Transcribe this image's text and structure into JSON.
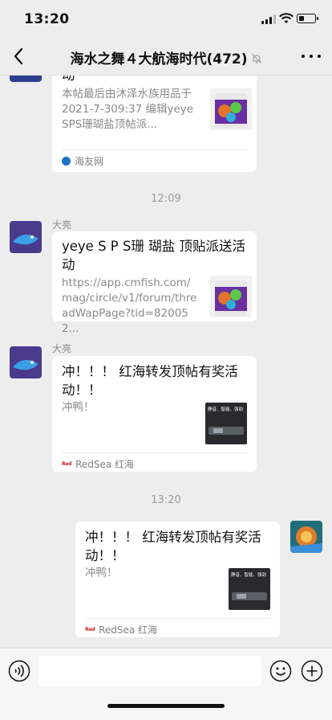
{
  "status": {
    "time": "13:20",
    "battery_level": 0.35
  },
  "header": {
    "title": "海水之舞４大航海时代(472)"
  },
  "messages": [
    {
      "title_partial": "动",
      "desc": "本帖最后由沐泽水族用品于 2021-7-309:37 编辑yeyeSPS珊瑚盐顶帖派...",
      "source": "海友网"
    },
    {
      "time": "12:09"
    },
    {
      "sender": "大亮",
      "title": "yeye S P S珊 瑚盐 顶贴派送活动",
      "desc": "https://app.cmfish.com/mag/circle/v1/forum/threadWapPage?tid=820052...",
      "source": ""
    },
    {
      "sender": "大亮",
      "title": "冲！！！ 红海转发顶帖有奖活动！！",
      "desc": "冲鸭！",
      "source_badge": "Red",
      "source": "RedSea 红海",
      "thumb_caption": "静音、智能、强劲"
    },
    {
      "time": "13:20"
    },
    {
      "title": "冲！！！ 红海转发顶帖有奖活动！！",
      "desc": "冲鸭！",
      "source_badge": "Red",
      "source": "RedSea 红海",
      "thumb_caption": "静音、智能、强劲"
    }
  ],
  "input": {
    "placeholder": ""
  }
}
